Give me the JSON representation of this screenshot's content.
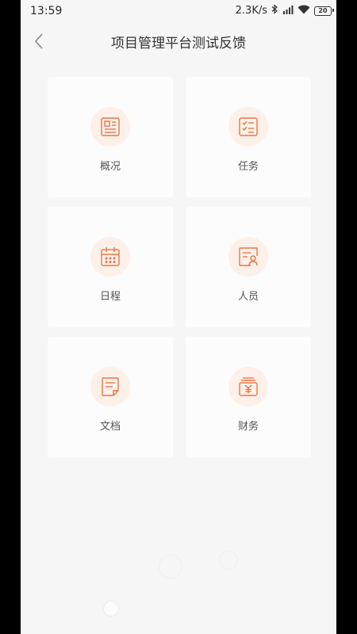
{
  "status_bar": {
    "time": "13:59",
    "network_speed": "2.3K/s",
    "battery": "20"
  },
  "header": {
    "title": "项目管理平台测试反馈",
    "back_icon": "chevron-left-icon"
  },
  "modules": [
    {
      "label": "概况",
      "icon": "overview-icon"
    },
    {
      "label": "任务",
      "icon": "task-checklist-icon"
    },
    {
      "label": "日程",
      "icon": "calendar-icon"
    },
    {
      "label": "人员",
      "icon": "person-card-icon"
    },
    {
      "label": "文档",
      "icon": "document-icon"
    },
    {
      "label": "财务",
      "icon": "finance-icon"
    }
  ],
  "colors": {
    "accent": "#e8774a",
    "icon_bg": "#fdf0e8",
    "background": "#f7f6f6",
    "card": "#fdfcfc"
  }
}
